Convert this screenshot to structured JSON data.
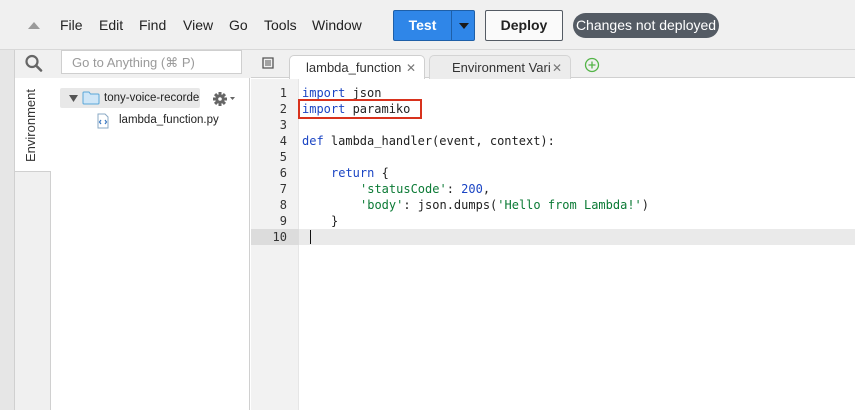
{
  "menu": {
    "items": [
      "File",
      "Edit",
      "Find",
      "View",
      "Go",
      "Tools",
      "Window"
    ]
  },
  "toolbar": {
    "test_label": "Test",
    "deploy_label": "Deploy",
    "status_text": "Changes not deployed",
    "accent_color": "#2f86e8",
    "status_color": "#545b64"
  },
  "sidebar": {
    "search_placeholder": "Go to Anything (⌘ P)",
    "tab_label": "Environment",
    "folder_name": "tony-voice-recorder",
    "file_name": "lambda_function.py"
  },
  "editor": {
    "tabs": [
      {
        "label": "lambda_function",
        "active": true
      },
      {
        "label": "Environment Vari",
        "active": false
      }
    ],
    "line_numbers": [
      "1",
      "2",
      "3",
      "4",
      "5",
      "6",
      "7",
      "8",
      "9",
      "10"
    ],
    "lines": [
      {
        "kw": "import",
        "rest": " json"
      },
      {
        "kw": "import",
        "rest": " paramiko"
      },
      {
        "kw": "",
        "rest": ""
      },
      {
        "kw": "def",
        "rest": " lambda_handler(event, context):"
      },
      {
        "kw": "",
        "rest": ""
      },
      {
        "kw": "return",
        "rest": " {"
      },
      {
        "str": "'statusCode'",
        "mid": ": ",
        "num": "200",
        "end": ","
      },
      {
        "str": "'body'",
        "mid": ": json.dumps(",
        "str2": "'Hello from Lambda!'",
        "end": ")"
      },
      {
        "kw": "",
        "rest": "}"
      },
      {
        "kw": "",
        "rest": ""
      }
    ],
    "highlight_color": "#d8321d"
  }
}
